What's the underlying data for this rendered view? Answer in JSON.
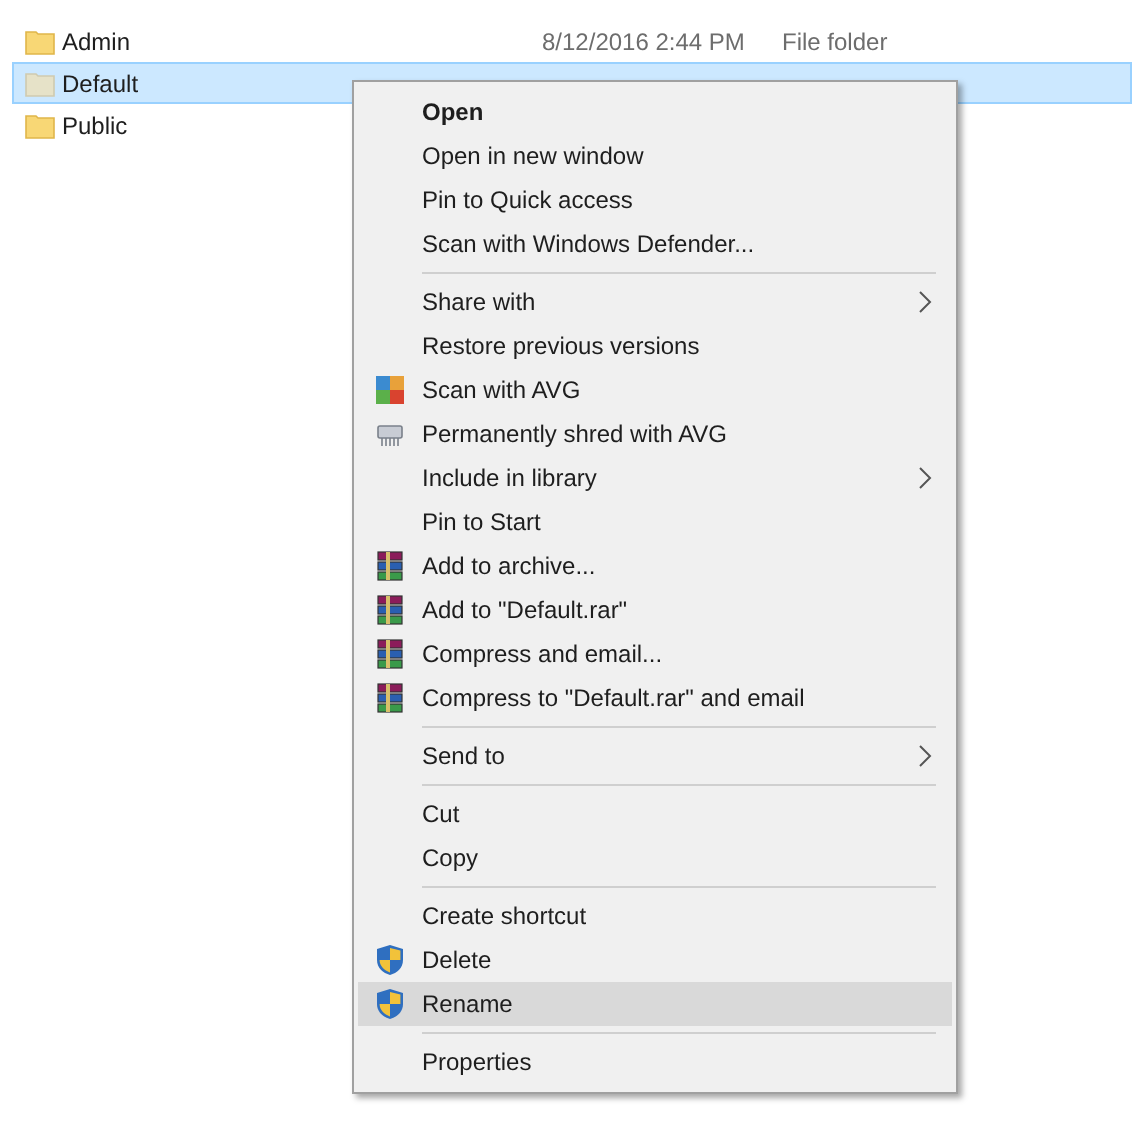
{
  "files": [
    {
      "name": "Admin",
      "date": "8/12/2016 2:44 PM",
      "type": "File folder",
      "selected": false
    },
    {
      "name": "Default",
      "selected": true
    },
    {
      "name": "Public",
      "selected": false
    }
  ],
  "context_menu": {
    "groups": [
      {
        "items": [
          {
            "label": "Open",
            "bold": true,
            "submenu": false,
            "selected": false
          },
          {
            "label": "Open in new window",
            "bold": false,
            "submenu": false,
            "selected": false
          },
          {
            "label": "Pin to Quick access",
            "bold": false,
            "submenu": false,
            "selected": false
          },
          {
            "label": "Scan with Windows Defender...",
            "bold": false,
            "submenu": false,
            "selected": false
          }
        ]
      },
      {
        "items": [
          {
            "label": "Share with",
            "bold": false,
            "submenu": true,
            "selected": false
          },
          {
            "label": "Restore previous versions",
            "bold": false,
            "submenu": false,
            "selected": false
          },
          {
            "label": "Scan with AVG",
            "kind": "avg",
            "bold": false,
            "submenu": false,
            "selected": false
          },
          {
            "label": "Permanently shred with AVG",
            "kind": "shredder",
            "bold": false,
            "submenu": false,
            "selected": false
          },
          {
            "label": "Include in library",
            "bold": false,
            "submenu": true,
            "selected": false
          },
          {
            "label": "Pin to Start",
            "bold": false,
            "submenu": false,
            "selected": false
          },
          {
            "label": "Add to archive...",
            "kind": "archive",
            "bold": false,
            "submenu": false,
            "selected": false
          },
          {
            "label": "Add to \"Default.rar\"",
            "kind": "archive",
            "bold": false,
            "submenu": false,
            "selected": false
          },
          {
            "label": "Compress and email...",
            "kind": "archive",
            "bold": false,
            "submenu": false,
            "selected": false
          },
          {
            "label": "Compress to \"Default.rar\" and email",
            "kind": "archive",
            "bold": false,
            "submenu": false,
            "selected": false
          }
        ]
      },
      {
        "items": [
          {
            "label": "Send to",
            "bold": false,
            "submenu": true,
            "selected": false
          }
        ]
      },
      {
        "items": [
          {
            "label": "Cut",
            "bold": false,
            "submenu": false,
            "selected": false
          },
          {
            "label": "Copy",
            "bold": false,
            "submenu": false,
            "selected": false
          }
        ]
      },
      {
        "items": [
          {
            "label": "Create shortcut",
            "bold": false,
            "submenu": false,
            "selected": false
          },
          {
            "label": "Delete",
            "kind": "shield",
            "bold": false,
            "submenu": false,
            "selected": false
          },
          {
            "label": "Rename",
            "kind": "shield",
            "bold": false,
            "submenu": false,
            "selected": true
          }
        ]
      },
      {
        "items": [
          {
            "label": "Properties",
            "bold": false,
            "submenu": false,
            "selected": false
          }
        ]
      }
    ]
  }
}
